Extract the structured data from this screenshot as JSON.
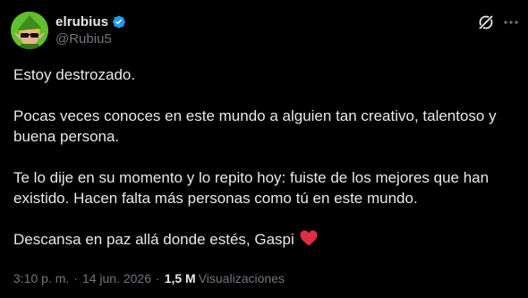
{
  "author": {
    "display_name": "elrubius",
    "handle": "@Rubiu5",
    "verified": true,
    "avatar_icon": "link-character-avatar"
  },
  "header_actions": {
    "grok_icon": "grok-icon",
    "more_icon": "more-icon"
  },
  "tweet": {
    "paragraphs": [
      "Estoy destrozado.",
      "Pocas veces conoces en este mundo a alguien tan creativo, talentoso y buena persona.",
      "Te lo dije en su momento y lo repito hoy: fuiste de los mejores que han existido. Hacen falta más personas como tú en este mundo.",
      "Descansa en paz allá donde estés, Gaspi"
    ],
    "trailing_emoji": "red-heart-emoji"
  },
  "meta": {
    "time": "3:10 p. m.",
    "separator": "·",
    "date": "14 jun. 2026",
    "views_count": "1,5 M",
    "views_label": "Visualizaciones"
  },
  "colors": {
    "background": "#000000",
    "text_primary": "#e7e9ea",
    "text_secondary": "#71767b",
    "verified_blue": "#1d9bf0",
    "heart_red": "#f91880"
  }
}
